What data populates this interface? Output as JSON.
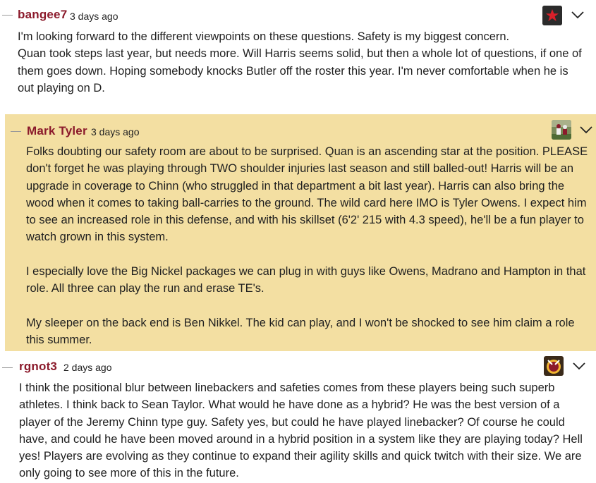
{
  "comments": [
    {
      "username": "bangee7",
      "timestamp": "3 days ago",
      "avatar_icon": "red-star-icon",
      "paragraphs": [
        "I'm looking forward to the different viewpoints on these questions. Safety is my biggest concern.\nQuan took steps last year, but needs more. Will Harris seems solid, but then a whole lot of questions, if one of them goes down. Hoping somebody knocks Butler off the roster this year. I'm never comfortable when he is out playing on D."
      ]
    },
    {
      "username": "Mark Tyler",
      "timestamp": "3 days ago",
      "avatar_icon": "football-player-photo-icon",
      "highlight_color": "#f3dfa2",
      "paragraphs": [
        "Folks doubting our safety room are about to be surprised. Quan is an ascending star at the position. PLEASE don't forget he was playing through TWO shoulder injuries last season and still balled-out! Harris will be an upgrade in coverage to Chinn (who struggled in that department a bit last year). Harris can also bring the wood when it comes to taking ball-carries to the ground. The wild card here IMO is Tyler Owens. I expect him to see an increased role in this defense, and with his skillset (6'2' 215 with 4.3 speed), he'll be a fun player to watch grown in this system.",
        "I especially love the Big Nickel packages we can plug in with guys like Owens, Madrano and Hampton in that role. All three can play the run and erase TE's.",
        "My sleeper on the back end is Ben Nikkel. The kid can play, and I won't be shocked to see him claim a role this summer."
      ]
    },
    {
      "username": "rgnot3",
      "timestamp": "2 days ago",
      "avatar_icon": "helmet-logo-icon",
      "paragraphs": [
        "I think the positional blur between linebackers and safeties comes from these players being such superb athletes. I think back to Sean Taylor. What would he have done as a hybrid? He was the best version of a player of the Jeremy Chinn type guy. Safety yes, but could he have played linebacker? Of course he could have, and could he have been moved around in a hybrid position in a system like they are playing today? Hell yes! Players are evolving as they continue to expand their agility skills and quick twitch with their size. We are only going to see more of this in the future."
      ]
    }
  ],
  "menu_icon": "chevron-down-icon",
  "colors": {
    "username": "#8b1a2b",
    "highlight": "#f3dfa2",
    "text": "#1f1f1f"
  }
}
